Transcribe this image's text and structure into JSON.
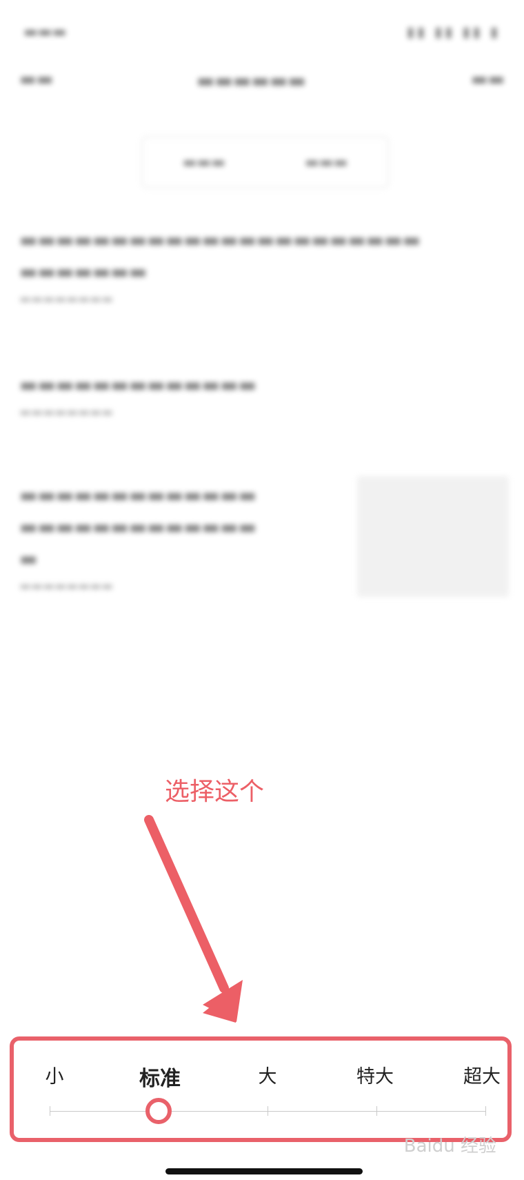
{
  "annotation": {
    "text": "选择这个",
    "color": "#ec5f66"
  },
  "font_size_picker": {
    "options": [
      "小",
      "标准",
      "大",
      "特大",
      "超大"
    ],
    "selected_index": 1,
    "accent_color": "#e9616a"
  },
  "watermark": "Baidu 经验"
}
